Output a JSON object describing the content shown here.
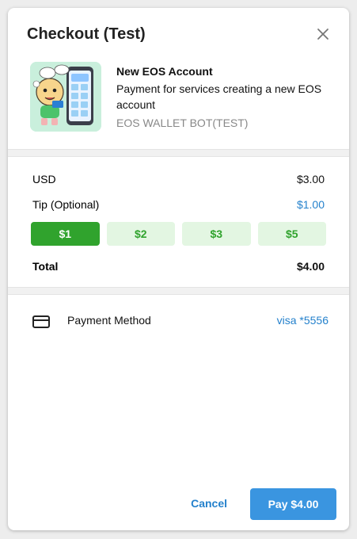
{
  "dialog": {
    "title": "Checkout (Test)",
    "close_icon": "close-icon"
  },
  "product": {
    "name": "New EOS Account",
    "description": "Payment for services creating a new EOS account",
    "bot": "EOS WALLET BOT(TEST)",
    "image_icon": "product-illustration"
  },
  "prices": {
    "currency_label": "USD",
    "currency_value": "$3.00",
    "tip_label": "Tip (Optional)",
    "tip_value": "$1.00",
    "tip_options": [
      "$1",
      "$2",
      "$3",
      "$5"
    ],
    "selected_tip_index": 0,
    "total_label": "Total",
    "total_value": "$4.00"
  },
  "payment": {
    "icon": "credit-card-icon",
    "label": "Payment Method",
    "value": "visa *5556"
  },
  "footer": {
    "cancel_label": "Cancel",
    "pay_label": "Pay $4.00"
  },
  "colors": {
    "accent_blue": "#2481cc",
    "pay_button": "#3a95e0",
    "tip_active": "#30a32d",
    "tip_inactive_bg": "#e3f6e2"
  }
}
